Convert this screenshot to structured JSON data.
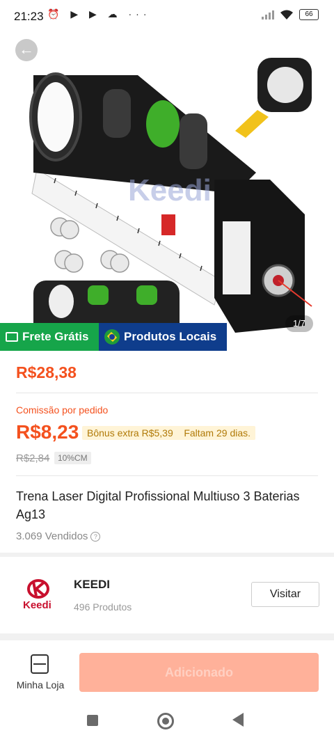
{
  "status_bar": {
    "time": "21:23",
    "battery": "66",
    "icons": "⏰ ▶ ▶ ☁ ···"
  },
  "gallery": {
    "counter": "1/7",
    "watermark": "Keedi"
  },
  "badges": {
    "free_shipping": "Frete Grátis",
    "local_products": "Produtos Locais"
  },
  "product": {
    "price": "R$28,38",
    "commission_label": "Comissão por pedido",
    "commission_value": "R$8,23",
    "bonus_text": "Bônus extra R$5,39",
    "remaining_text": "Faltam 29 dias.",
    "old_price": "R$2,84",
    "cm_tag": "10%CM",
    "title": "Trena Laser Digital Profissional Multiuso 3 Baterias Ag13",
    "sold": "3.069 Vendidos"
  },
  "store": {
    "name": "KEEDI",
    "products": "496 Produtos",
    "visit_label": "Visitar",
    "logo_text": "Keedi"
  },
  "bottom": {
    "my_store_label": "Minha Loja",
    "add_label": "Adicionado"
  },
  "colors": {
    "accent": "#f4511e",
    "green": "#16a54a",
    "blue": "#0f3d8c"
  }
}
